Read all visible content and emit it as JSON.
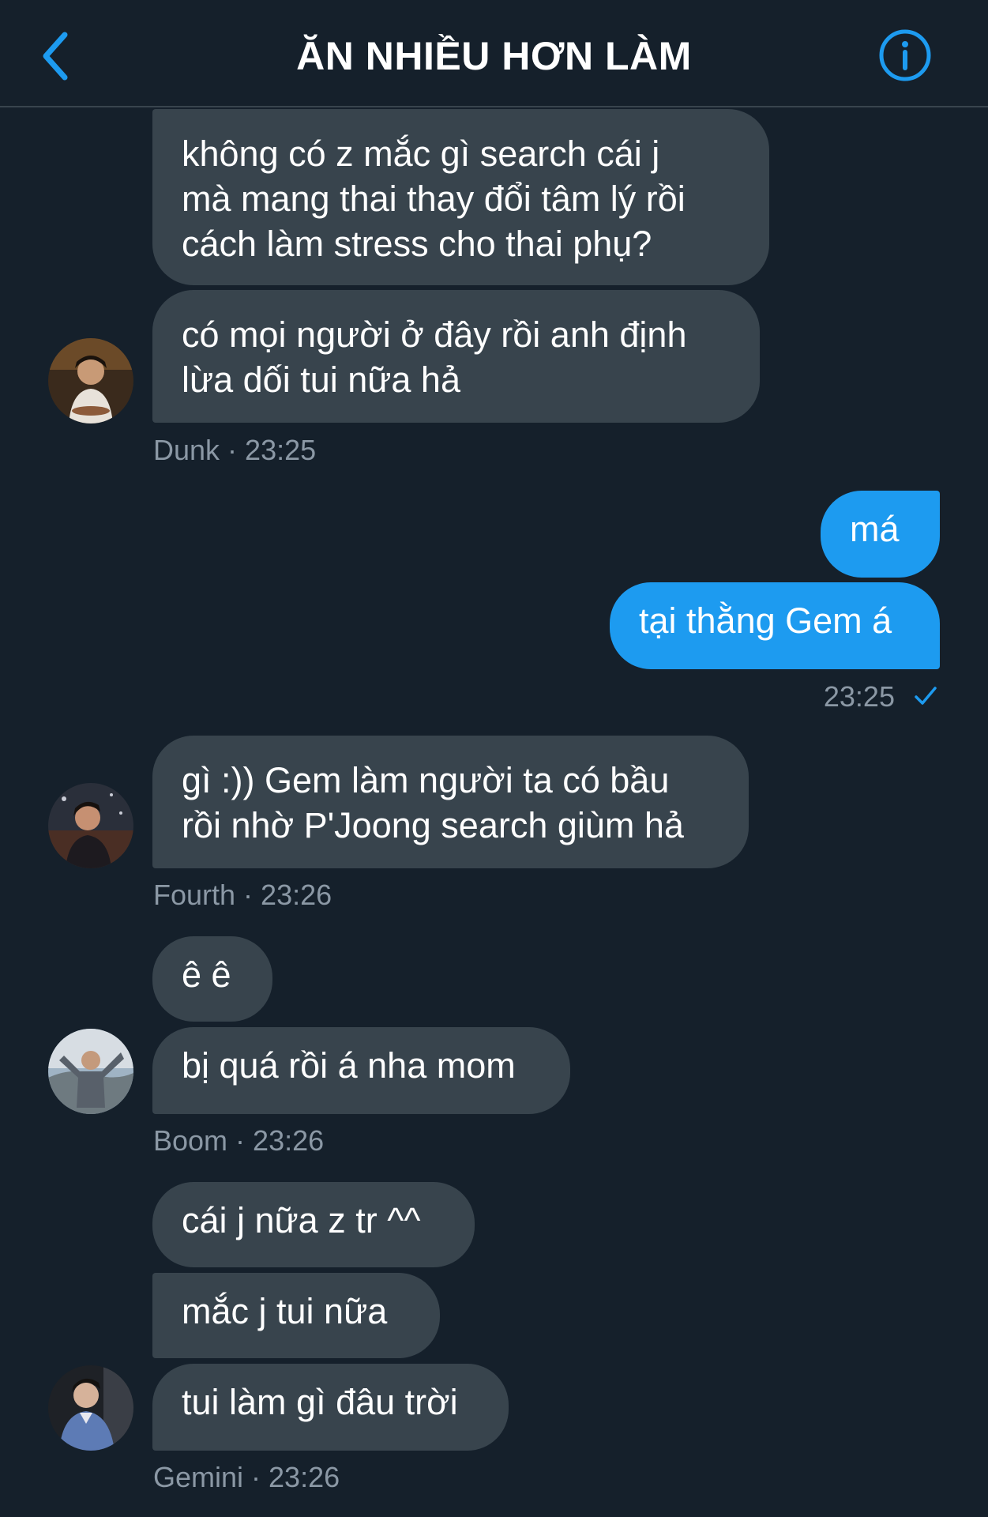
{
  "header": {
    "title": "ĂN NHIỀU HƠN LÀM",
    "back_icon": "chevron-left-icon",
    "info_icon": "info-icon"
  },
  "colors": {
    "background": "#15202b",
    "incoming_bubble": "#38444d",
    "outgoing_bubble": "#1d9bf0",
    "accent": "#1d9bf0",
    "meta_text": "#8b98a5"
  },
  "messages": [
    {
      "sender": "Dunk",
      "time": "23:25",
      "bubbles": [
        [
          "không có z mắc gì search cái j",
          "mà mang thai thay đổi tâm lý rồi",
          "cách làm stress cho thai phụ?"
        ],
        [
          "có mọi người ở đây rồi anh định",
          "lừa dối tui nữa hả"
        ]
      ]
    },
    {
      "sender": "me",
      "time": "23:25",
      "bubbles": [
        [
          "má"
        ],
        [
          "tại thằng Gem á"
        ]
      ]
    },
    {
      "sender": "Fourth",
      "time": "23:26",
      "bubbles": [
        [
          "gì :)) Gem làm người ta có bầu",
          "rồi nhờ P'Joong search giùm hả"
        ]
      ]
    },
    {
      "sender": "Boom",
      "time": "23:26",
      "bubbles": [
        [
          "ê ê"
        ],
        [
          "bị quá rồi á nha mom"
        ]
      ]
    },
    {
      "sender": "Gemini",
      "time": "23:26",
      "bubbles": [
        [
          "cái j nữa z tr ^^"
        ],
        [
          "mắc j tui nữa"
        ],
        [
          "tui làm gì đâu trời"
        ]
      ]
    }
  ],
  "meta_separator": " · "
}
